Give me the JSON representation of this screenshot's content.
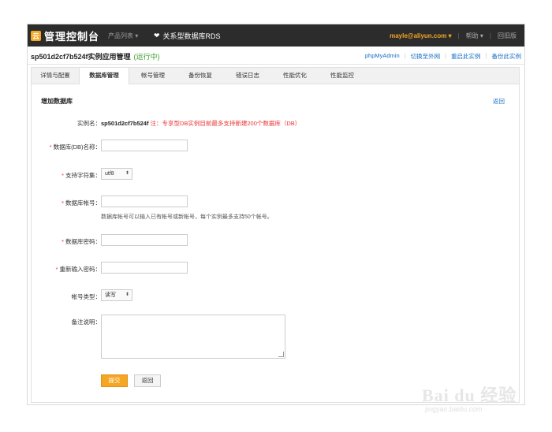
{
  "header": {
    "logo_glyph": "云",
    "logo_text": "管理控制台",
    "products_menu": "产品列表 ▾",
    "rds_heart": "❤",
    "rds_title": "关系型数据库RDS",
    "user": "mayle@aliyun.com ▾",
    "help": "帮助 ▾",
    "old_version": "回旧版",
    "separator": "|"
  },
  "title_bar": {
    "instance_title": "sp501d2cf7b524f实例应用管理",
    "status": "(运行中)",
    "links": [
      "phpMyAdmin",
      "切换至外网",
      "重启此实例",
      "备份此实例"
    ]
  },
  "tabs": [
    {
      "label": "详情与配置",
      "active": false
    },
    {
      "label": "数据库管理",
      "active": true
    },
    {
      "label": "帐号管理",
      "active": false
    },
    {
      "label": "备份恢复",
      "active": false
    },
    {
      "label": "错误日志",
      "active": false
    },
    {
      "label": "性能优化",
      "active": false
    },
    {
      "label": "性能监控",
      "active": false
    }
  ],
  "form": {
    "title": "增加数据库",
    "back_link": "返回",
    "instance_label": "实例名：",
    "instance_name": "sp501d2cf7b524f",
    "instance_note": "注：专享型DB实例目前最多支持新建200个数据库（DB）",
    "required_mark": "*",
    "db_name_label": "数据库(DB)名称：",
    "db_name_value": "",
    "charset_label": "支持字符集：",
    "charset_value": "utf8",
    "select_arrow": "⬍",
    "account_label": "数据库帐号：",
    "account_value": "",
    "account_hint": "数据库帐号可以输入已有帐号或新帐号，每个实例最多支持50个帐号。",
    "password_label": "数据库密码：",
    "password_value": "",
    "repassword_label": "重新输入密码：",
    "repassword_value": "",
    "account_type_label": "帐号类型：",
    "account_type_value": "读写",
    "remark_label": "备注说明：",
    "submit_label": "提交",
    "cancel_label": "返回"
  },
  "watermark": {
    "brand": "Bai du 经验",
    "url": "jingyan.baidu.com"
  }
}
